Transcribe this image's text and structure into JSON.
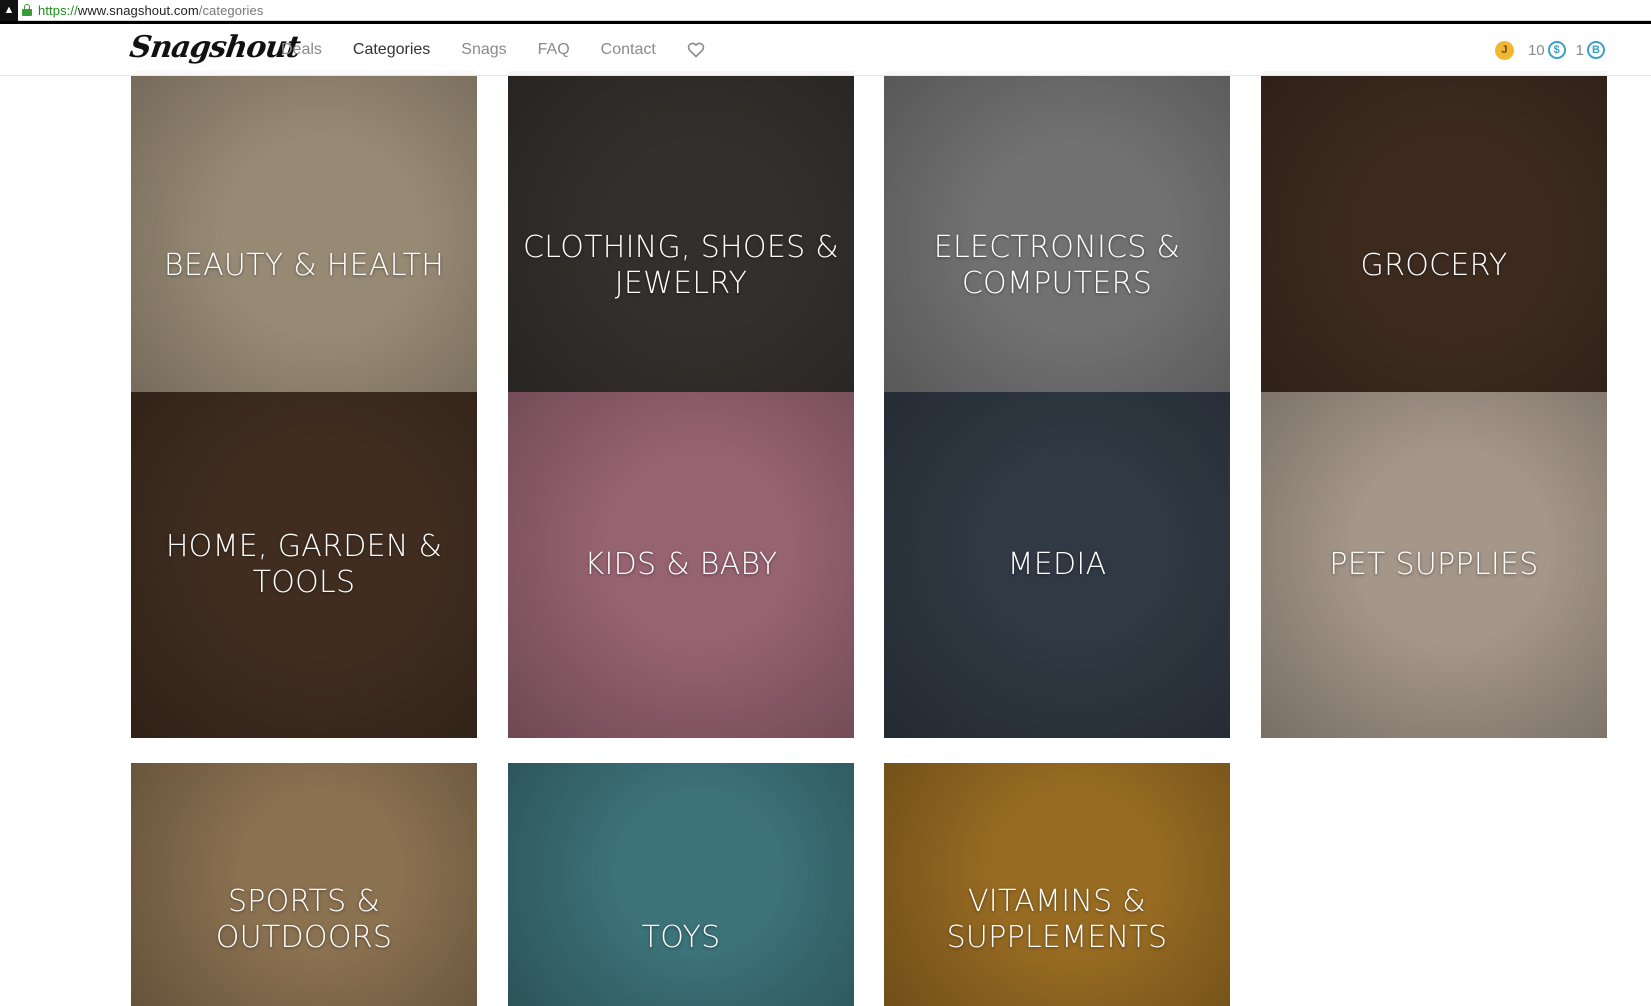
{
  "browser": {
    "url_protocol": "https://",
    "url_host": "www.snagshout.com",
    "url_path": "/categories"
  },
  "nav": {
    "logo": "Snagshout",
    "links": [
      {
        "label": "Deals",
        "active": false
      },
      {
        "label": "Categories",
        "active": true
      },
      {
        "label": "Snags",
        "active": false
      },
      {
        "label": "FAQ",
        "active": false
      },
      {
        "label": "Contact",
        "active": false
      }
    ],
    "user": {
      "avatar_initial": "J",
      "points": "10",
      "badges": "1"
    }
  },
  "categories": [
    {
      "label": "BEAUTY & HEALTH",
      "color": "#b9a98f"
    },
    {
      "label": "CLOTHING, SHOES & JEWELRY",
      "color": "#3e3a36"
    },
    {
      "label": "ELECTRONICS & COMPUTERS",
      "color": "#8a8a8a"
    },
    {
      "label": "GROCERY",
      "color": "#4a3426"
    },
    {
      "label": "HOME, GARDEN & TOOLS",
      "color": "#4f3828"
    },
    {
      "label": "KIDS & BABY",
      "color": "#b8798a"
    },
    {
      "label": "MEDIA",
      "color": "#3b4653"
    },
    {
      "label": "PET SUPPLIES",
      "color": "#c9b8a8"
    },
    {
      "label": "SPORTS & OUTDOORS",
      "color": "#a98a62"
    },
    {
      "label": "TOYS",
      "color": "#4a8b94"
    },
    {
      "label": "VITAMINS & SUPPLEMENTS",
      "color": "#b9832a"
    }
  ]
}
